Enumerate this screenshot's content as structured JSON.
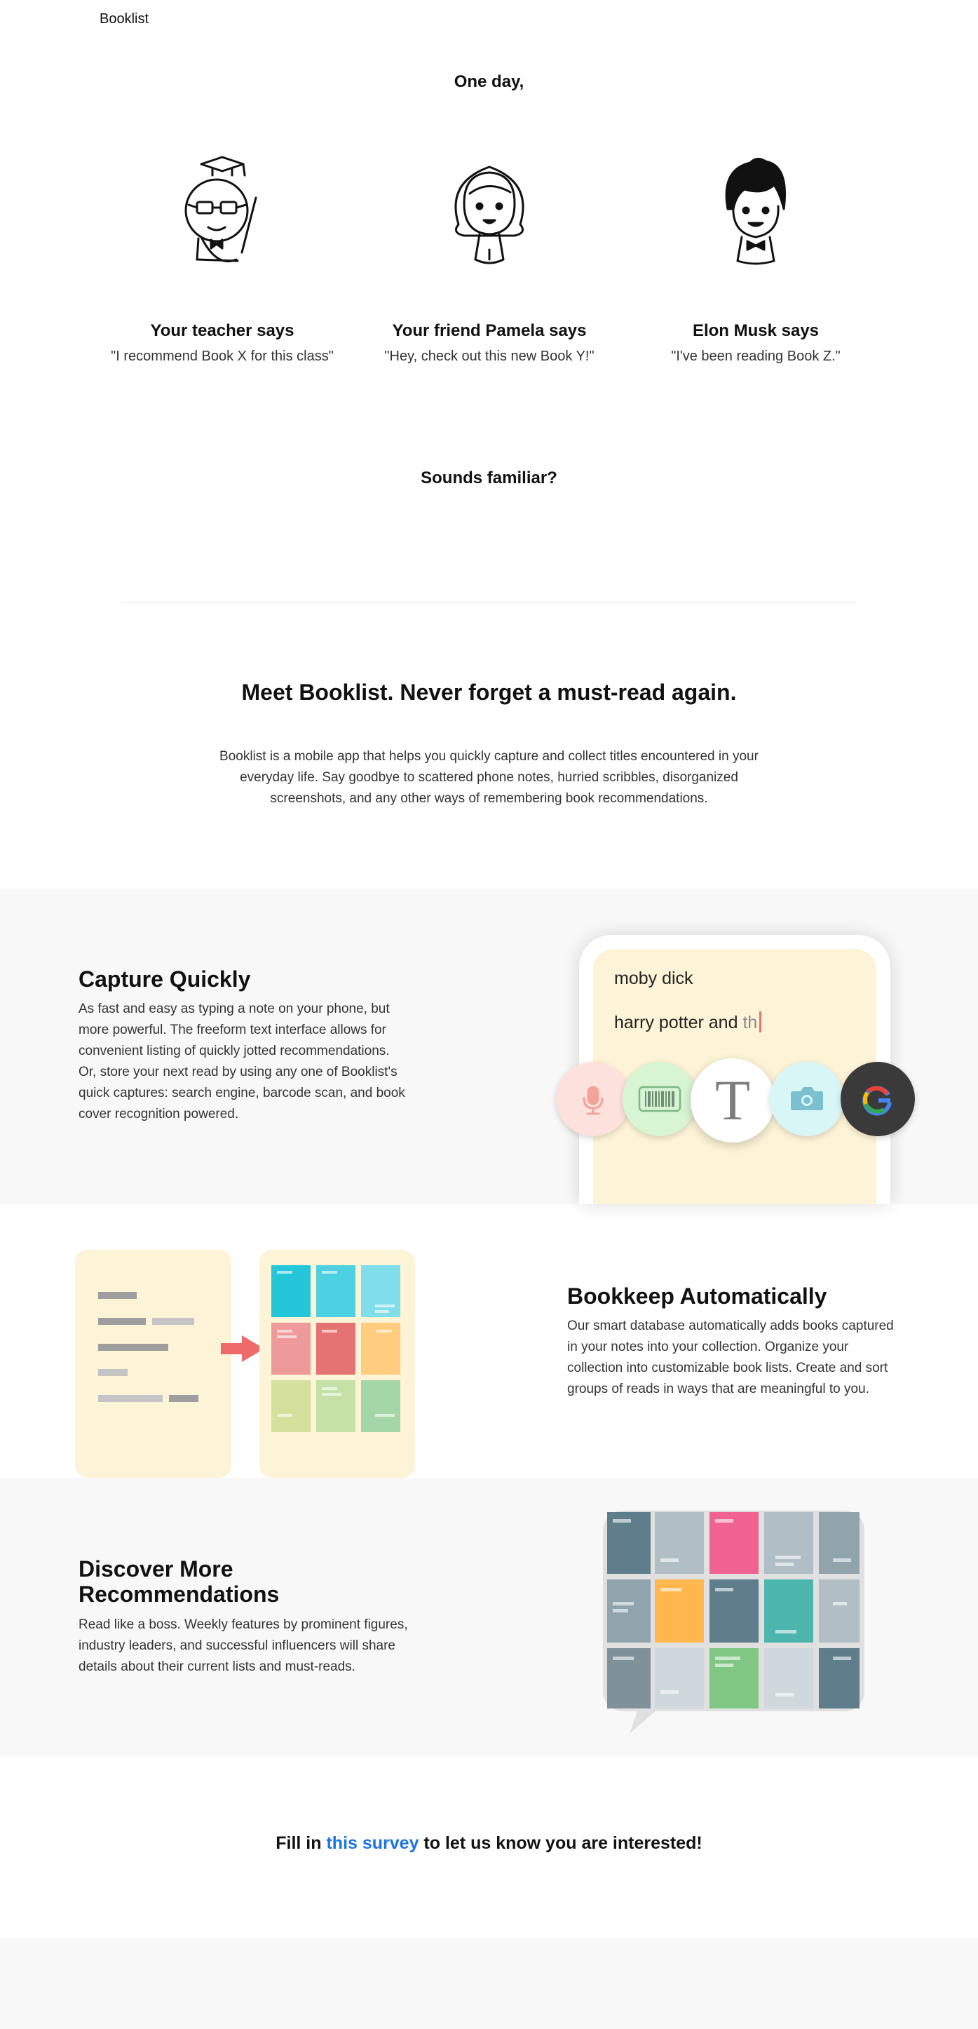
{
  "nav": {
    "brand": "Booklist"
  },
  "intro": {
    "heading": "One day,"
  },
  "people": [
    {
      "title": "Your teacher says",
      "quote": "\"I recommend Book X for this class\"",
      "avatar_icon": "teacher-avatar-icon"
    },
    {
      "title": "Your friend Pamela says",
      "quote": "\"Hey, check out this new Book Y!\"",
      "avatar_icon": "friend-avatar-icon"
    },
    {
      "title": "Elon Musk says",
      "quote": "\"I've been reading Book Z.\"",
      "avatar_icon": "elon-avatar-icon"
    }
  ],
  "familiar": {
    "heading": "Sounds familiar?"
  },
  "meet": {
    "heading": "Meet Booklist. Never forget a must-read again.",
    "body": "Booklist is a mobile app that helps you quickly capture and collect titles encountered in your everyday life. Say goodbye to scattered phone notes, hurried scribbles, disorganized screenshots, and any other ways of remembering book recommendations."
  },
  "features": {
    "capture": {
      "title": "Capture Quickly",
      "body": "As fast and easy as typing a note on your phone, but more powerful. The freeform text interface allows for convenient listing of quickly jotted recommendations. Or, store your next read by using any one of Booklist's quick captures: search engine, barcode scan, and book cover recognition powered.",
      "phone_notes": {
        "line1": "moby dick",
        "line2_typed": "harry potter and",
        "line2_pending": " th"
      },
      "quick_capture_icons": [
        "microphone-icon",
        "barcode-icon",
        "text-icon",
        "camera-icon",
        "google-icon"
      ]
    },
    "bookkeep": {
      "title": "Bookkeep Automatically",
      "body": "Our smart database automatically adds books captured in your notes into your collection. Organize your collection into customizable book lists. Create and sort groups of reads in ways that are meaningful to you."
    },
    "discover": {
      "title": "Discover More Recommendations",
      "body": "Read like a boss. Weekly features by prominent figures, industry leaders, and successful influencers will share details about their current lists and must-reads."
    }
  },
  "cta": {
    "before": "Fill in ",
    "link": "this survey",
    "after": " to let us know you are interested!"
  },
  "colors": {
    "accent_link": "#1a73e8",
    "band_bg": "#f8f8f8",
    "note_bg": "#fdf3d6",
    "arrow": "#ef6b6b",
    "bookkeep_tiles": [
      "#26c6da",
      "#4dd0e1",
      "#80deea",
      "#ef9a9a",
      "#e57373",
      "#ffcc80",
      "#d4e09b",
      "#c5e1a5",
      "#a5d6a7"
    ],
    "discover_tiles": [
      "#607d8b",
      "#b0bec5",
      "#f06292",
      "#b0bec5",
      "#90a4ae",
      "#90a4ae",
      "#ffb74d",
      "#607d8b",
      "#4db6ac",
      "#b0bec5",
      "#7f929c",
      "#cfd8dc",
      "#81c784",
      "#cfd8dc",
      "#607d8b"
    ]
  }
}
